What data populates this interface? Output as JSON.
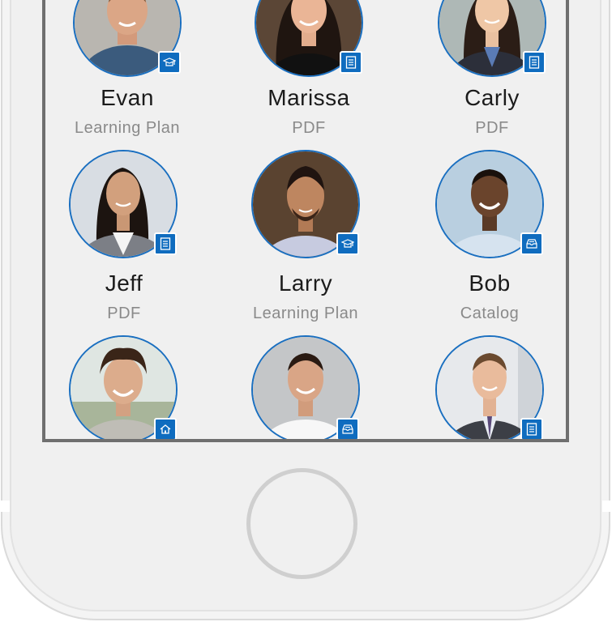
{
  "people": [
    {
      "name": "Evan",
      "type": "Learning Plan",
      "badge": "graduation-cap-icon"
    },
    {
      "name": "Marissa",
      "type": "PDF",
      "badge": "document-icon"
    },
    {
      "name": "Carly",
      "type": "PDF",
      "badge": "document-icon"
    },
    {
      "name": "Jeff",
      "type": "PDF",
      "badge": "document-icon"
    },
    {
      "name": "Larry",
      "type": "Learning Plan",
      "badge": "graduation-cap-icon"
    },
    {
      "name": "Bob",
      "type": "Catalog",
      "badge": "catalog-tray-icon"
    },
    {
      "name": "",
      "type": "",
      "badge": "home-icon"
    },
    {
      "name": "",
      "type": "",
      "badge": "catalog-tray-icon"
    },
    {
      "name": "",
      "type": "",
      "badge": "document-icon"
    }
  ],
  "colors": {
    "accent": "#0f6cbf",
    "avatar_ring": "#1a6fc0",
    "device_body": "#f0f0f0",
    "screen_border": "#6f6f6f",
    "name_text": "#1b1b1b",
    "type_text": "#8a8a8a"
  }
}
